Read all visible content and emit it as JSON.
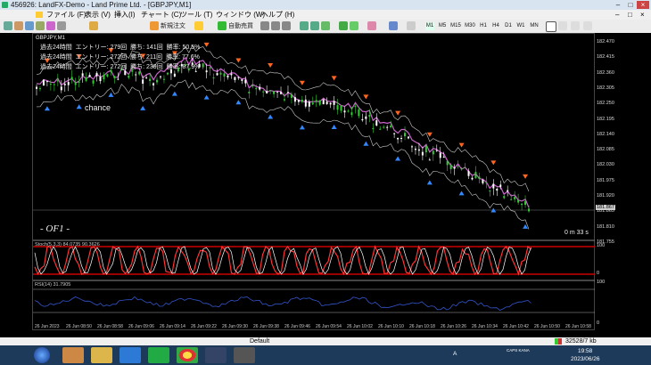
{
  "window": {
    "title": "456926: LandFX-Demo - Land Prime Ltd. - [GBPJPY,M1]"
  },
  "menu": [
    "ファイル (F)",
    "表示 (V)",
    "挿入(I)",
    "チャート (C)",
    "ツール (T)",
    "ウィンドウ (W)",
    "ヘルプ (H)"
  ],
  "toolbar": {
    "new_order": "新規注文",
    "auto_trade": "自動売買",
    "timeframes": [
      "M1",
      "M5",
      "M15",
      "M30",
      "H1",
      "H4",
      "D1",
      "W1",
      "MN"
    ],
    "active_timeframe": "M1"
  },
  "chart": {
    "symbol_label": "GBPJPY,M1",
    "info_lines": [
      "過去24時間  エントリー: 279回  勝ち: 141回  勝率: 50.5%",
      "過去24時間  エントリー: 272回  勝ち: 211回  勝率: 77.6%",
      "過去24時間  エントリー: 272回  勝ち: 239回  勝率: 87.9%"
    ],
    "chance_label": "chance",
    "brand_label": "- OF1 -",
    "timer": "0 m 33 s",
    "price_ticks": [
      "182.470",
      "182.415",
      "182.360",
      "182.305",
      "182.250",
      "182.195",
      "182.140",
      "182.085",
      "182.030",
      "181.975",
      "181.920",
      "181.865",
      "181.810",
      "181.755"
    ],
    "current_price": "181.867",
    "stoch_label": "Stoch(5,3,3) 84.0735 90.3626",
    "stoch_ticks": [
      "100",
      "0"
    ],
    "rsi_label": "RSI(14) 31.7905",
    "rsi_ticks": [
      "100",
      "0"
    ],
    "time_ticks": [
      "26 Jun 2023",
      "26 Jun 08:50",
      "26 Jun 08:58",
      "26 Jun 09:06",
      "26 Jun 09:14",
      "26 Jun 09:22",
      "26 Jun 09:30",
      "26 Jun 09:38",
      "26 Jun 09:46",
      "26 Jun 09:54",
      "26 Jun 10:02",
      "26 Jun 10:10",
      "26 Jun 10:18",
      "26 Jun 10:26",
      "26 Jun 10:34",
      "26 Jun 10:42",
      "26 Jun 10:50",
      "26 Jun 10:58"
    ]
  },
  "statusbar": {
    "profile": "Default",
    "traffic": "32528/7 kb"
  },
  "taskbar": {
    "time": "19:58",
    "date": "2023/06/26",
    "ime": "A",
    "lang": "CAPS KANA"
  },
  "colors": {
    "bull": "#33cc33",
    "bear": "#ffffff",
    "band": "#cccccc",
    "ma": "#cc66cc",
    "stoch_main": "#ff3333",
    "stoch_signal": "#ffffff",
    "rsi": "#3355cc",
    "arrow_down": "#ff6622",
    "arrow_up": "#3388ff"
  }
}
